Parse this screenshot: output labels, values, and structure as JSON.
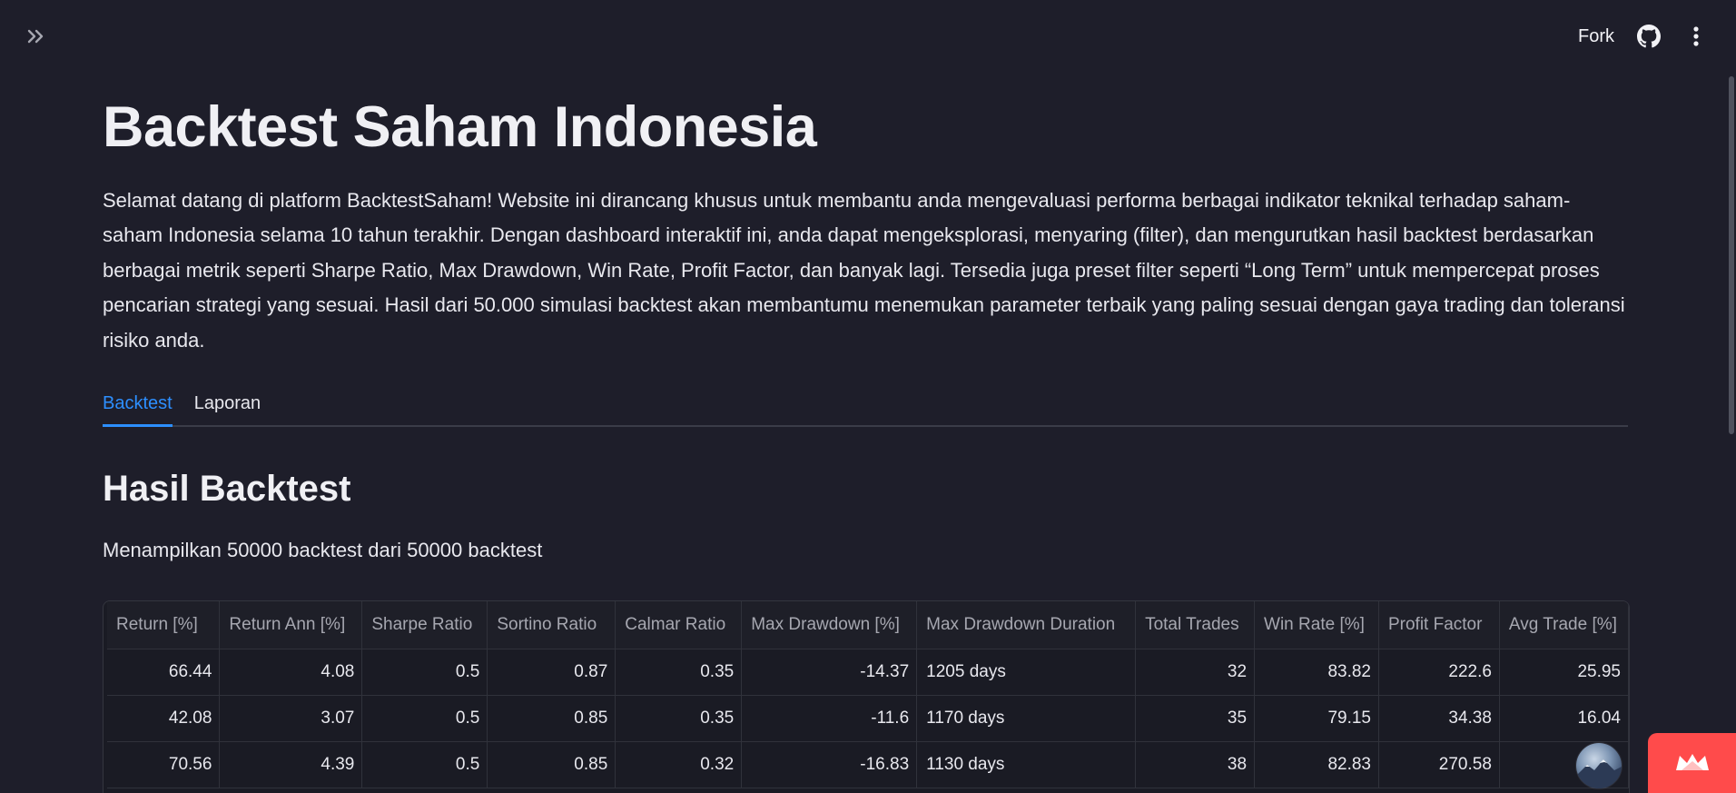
{
  "header": {
    "fork_label": "Fork",
    "icons": {
      "sidebar_toggle": "double-chevron-right-icon",
      "github": "github-icon",
      "menu": "kebab-menu-icon"
    }
  },
  "main": {
    "title": "Backtest Saham Indonesia",
    "intro": "Selamat datang di platform BacktestSaham! Website ini dirancang khusus untuk membantu anda mengevaluasi performa berbagai indikator teknikal terhadap saham-saham Indonesia selama 10 tahun terakhir. Dengan dashboard interaktif ini, anda dapat mengeksplorasi, menyaring (filter), dan mengurutkan hasil backtest berdasarkan berbagai metrik seperti Sharpe Ratio, Max Drawdown, Win Rate, Profit Factor, dan banyak lagi. Tersedia juga preset filter seperti “Long Term” untuk mempercepat proses pencarian strategi yang sesuai. Hasil dari 50.000 simulasi backtest akan membantumu menemukan parameter terbaik yang paling sesuai dengan gaya trading dan toleransi risiko anda.",
    "tabs": [
      {
        "label": "Backtest",
        "active": true
      },
      {
        "label": "Laporan",
        "active": false
      }
    ],
    "section_title": "Hasil Backtest",
    "caption": "Menampilkan 50000 backtest dari 50000 backtest"
  },
  "table": {
    "columns": [
      "Return [%]",
      "Return Ann [%]",
      "Sharpe Ratio",
      "Sortino Ratio",
      "Calmar Ratio",
      "Max Drawdown [%]",
      "Max Drawdown Duration",
      "Total Trades",
      "Win Rate [%]",
      "Profit Factor",
      "Avg Trade [%]"
    ],
    "rows": [
      [
        "66.44",
        "4.08",
        "0.5",
        "0.87",
        "0.35",
        "-14.37",
        "1205 days",
        "32",
        "83.82",
        "222.6",
        "25.95"
      ],
      [
        "42.08",
        "3.07",
        "0.5",
        "0.85",
        "0.35",
        "-11.6",
        "1170 days",
        "35",
        "79.15",
        "34.38",
        "16.04"
      ],
      [
        "70.56",
        "4.39",
        "0.5",
        "0.85",
        "0.32",
        "-16.83",
        "1130 days",
        "38",
        "82.83",
        "270.58",
        ""
      ]
    ]
  },
  "colors": {
    "background": "#1e1e2a",
    "accent": "#2d8fff",
    "streamlit_red": "#ff4b4b"
  }
}
